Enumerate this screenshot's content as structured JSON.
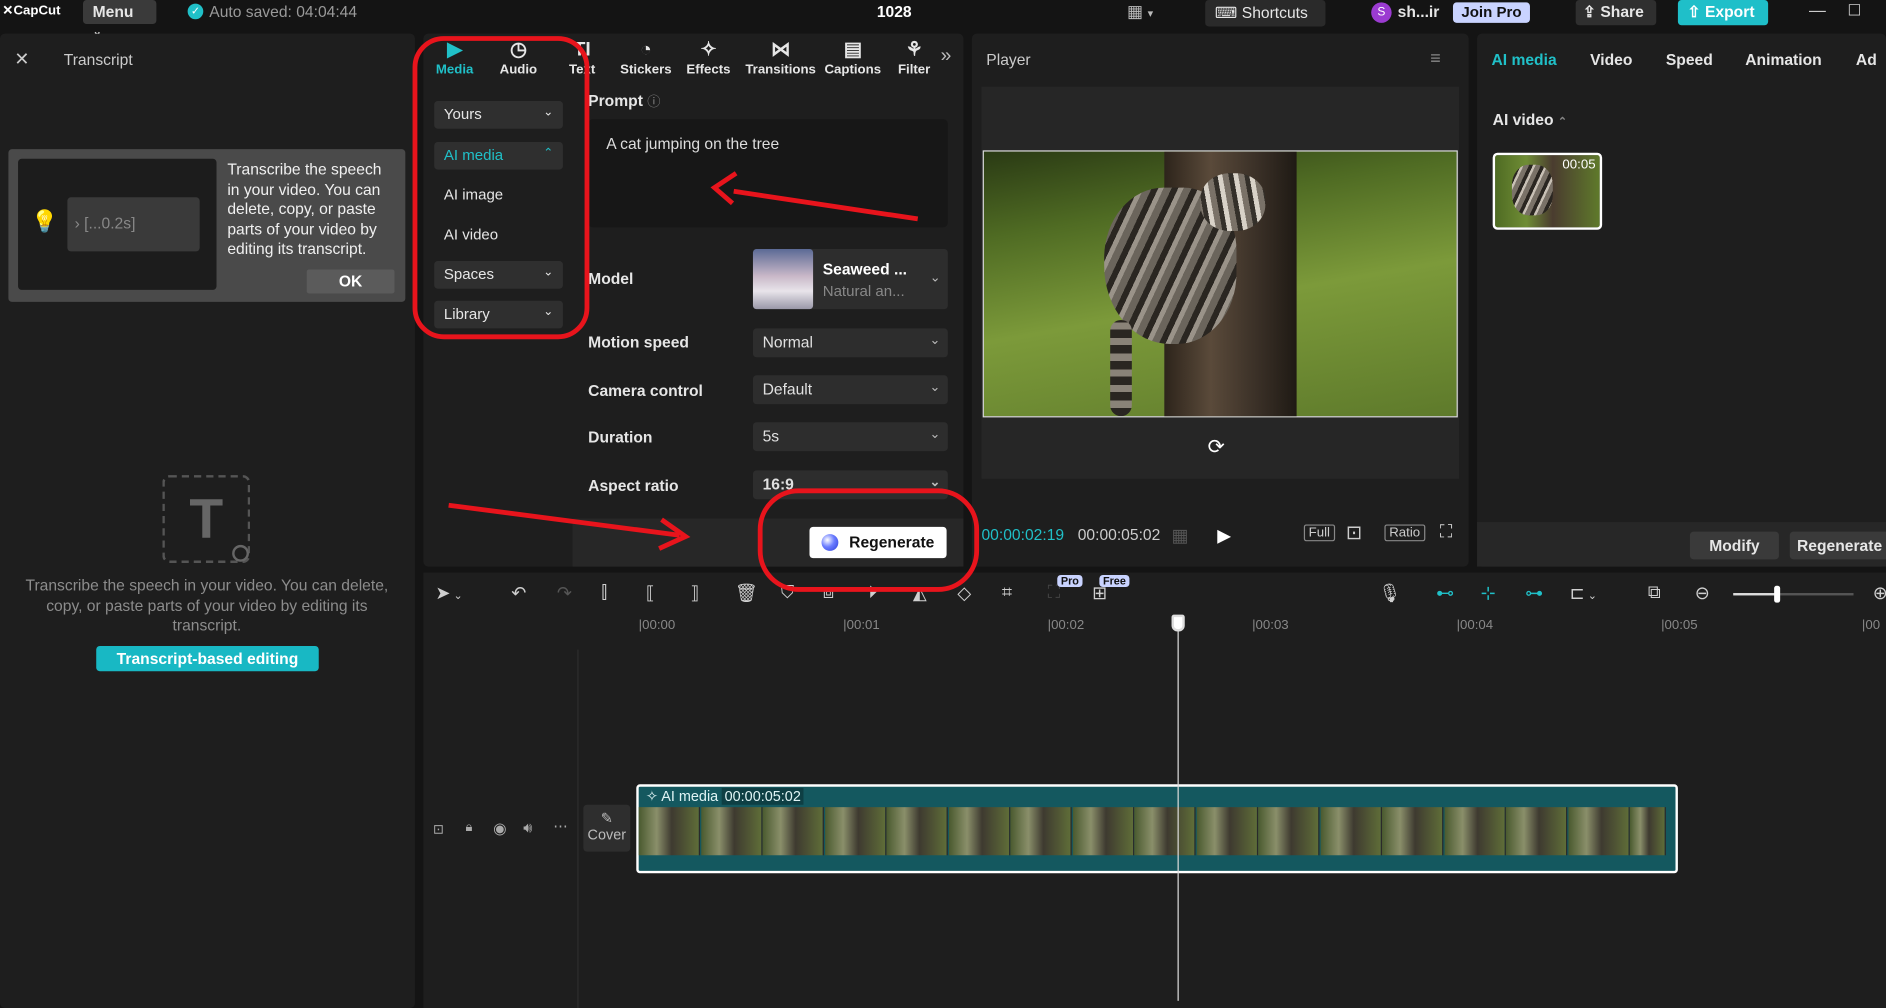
{
  "app": {
    "logo": "CapCut",
    "menu_label": "Menu",
    "autosave": "Auto saved: 04:04:44",
    "project_title": "1028",
    "shortcuts_label": "Shortcuts",
    "user_name": "sh...ir",
    "user_initial": "S",
    "join_pro_label": "Join Pro",
    "share_label": "Share",
    "export_label": "Export"
  },
  "transcript": {
    "title": "Transcript",
    "hint_text": "Transcribe the speech in your video. You can delete, copy, or paste parts of your video by editing its transcript.",
    "hint_sample": "[...0.2s]",
    "ok_label": "OK",
    "empty_text": "Transcribe the speech in your video. You can delete, copy, or paste parts of your video by editing its transcript.",
    "action_label": "Transcript-based editing"
  },
  "toolbar": {
    "tabs": [
      {
        "label": "Media",
        "icon": "media-icon"
      },
      {
        "label": "Audio",
        "icon": "audio-icon"
      },
      {
        "label": "Text",
        "icon": "text-icon"
      },
      {
        "label": "Stickers",
        "icon": "stickers-icon"
      },
      {
        "label": "Effects",
        "icon": "effects-icon"
      },
      {
        "label": "Transitions",
        "icon": "transitions-icon"
      },
      {
        "label": "Captions",
        "icon": "captions-icon"
      },
      {
        "label": "Filter",
        "icon": "filter-icon"
      }
    ],
    "active_tab": "Media"
  },
  "media_sidebar": {
    "yours": "Yours",
    "ai_media": "AI media",
    "ai_image": "AI image",
    "ai_video": "AI video",
    "spaces": "Spaces",
    "library": "Library"
  },
  "ai_form": {
    "prompt_label": "Prompt",
    "prompt_value": "A cat jumping on the tree",
    "model_label": "Model",
    "model_name": "Seaweed ...",
    "model_desc": "Natural an...",
    "motion_speed_label": "Motion speed",
    "motion_speed_value": "Normal",
    "camera_label": "Camera control",
    "camera_value": "Default",
    "duration_label": "Duration",
    "duration_value": "5s",
    "aspect_label": "Aspect ratio",
    "aspect_value": "16:9",
    "regenerate_label": "Regenerate"
  },
  "player": {
    "title": "Player",
    "current_time": "00:00:02:19",
    "total_time": "00:00:05:02",
    "full_label": "Full",
    "ratio_label": "Ratio"
  },
  "right_panel": {
    "tabs": [
      "AI media",
      "Video",
      "Speed",
      "Animation",
      "Ad"
    ],
    "section_label": "AI video",
    "thumb_duration": "00:05",
    "modify_label": "Modify",
    "regenerate_label": "Regenerate"
  },
  "timeline": {
    "ruler": [
      "|00:00",
      "|00:01",
      "|00:02",
      "|00:03",
      "|00:04",
      "|00:05",
      "|00"
    ],
    "cover_label": "Cover",
    "clip_label": "AI media",
    "clip_duration": "00:00:05:02",
    "pro_badge": "Pro",
    "free_badge": "Free"
  },
  "colors": {
    "accent": "#20c0c8",
    "annotation": "#e8141c",
    "join_pro_bg": "#c9d3ff",
    "export_bg": "#1fbfc9",
    "clip_bg": "#14585f"
  }
}
